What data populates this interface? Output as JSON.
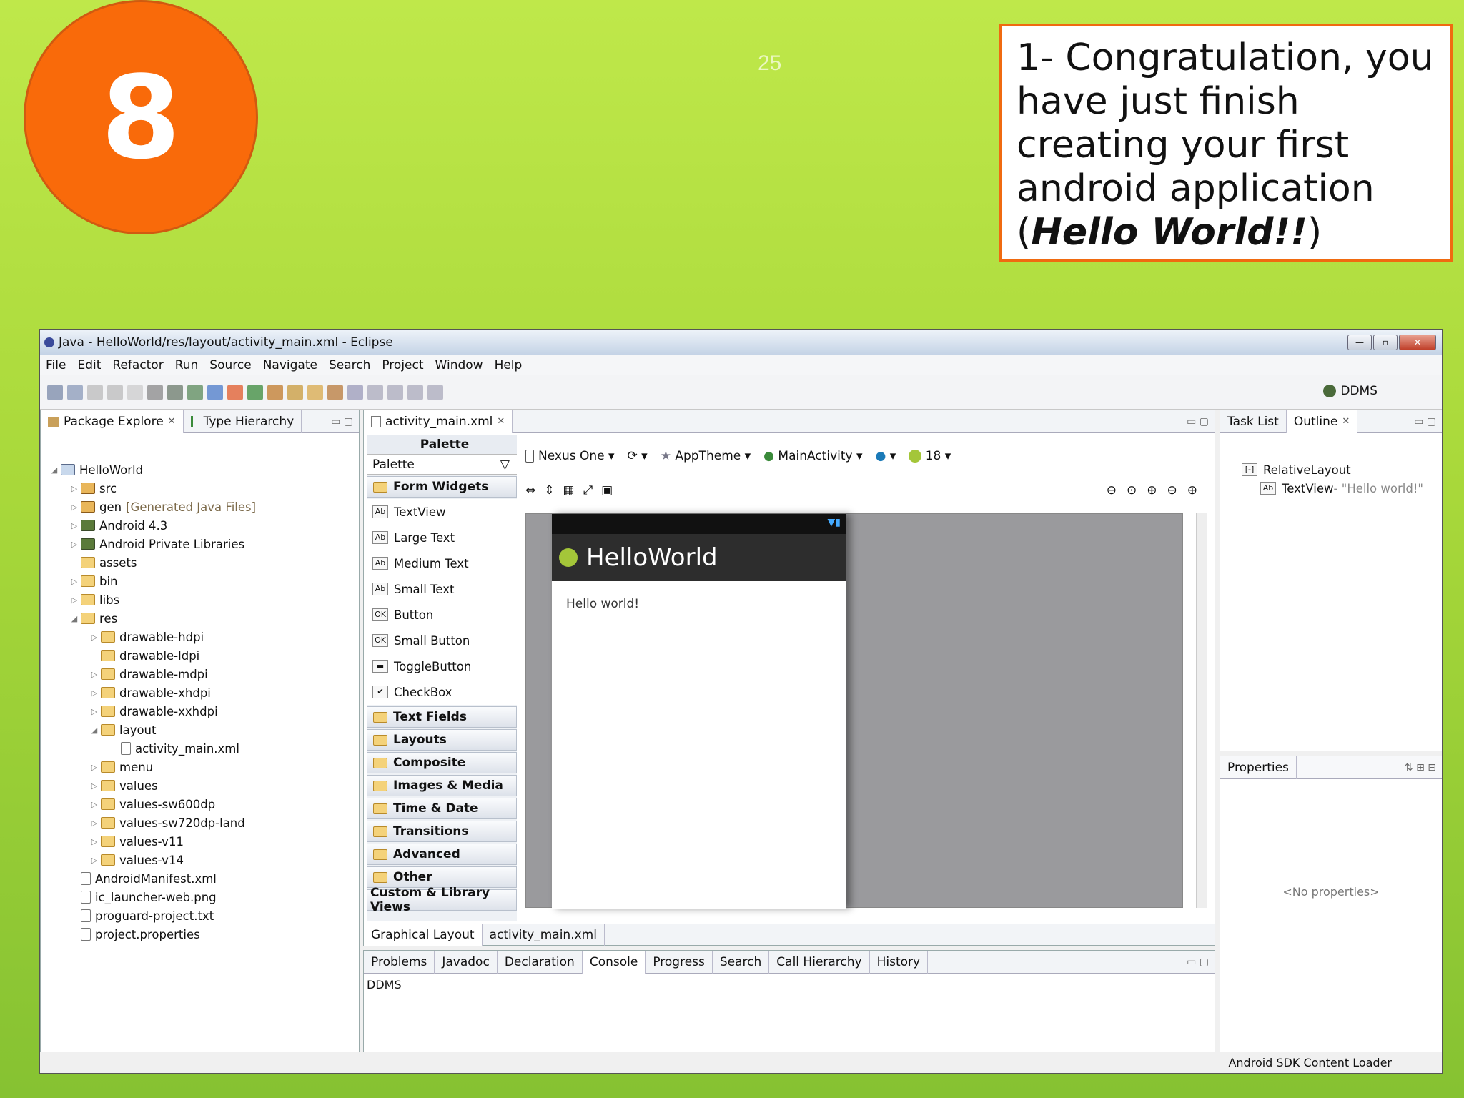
{
  "slide": {
    "step": "8",
    "page_number": "25",
    "callout_plain1": "1- Congratulation, you have just finish creating your first android application (",
    "callout_bold": "Hello World!!",
    "callout_plain2": ")"
  },
  "window": {
    "title": "Java - HelloWorld/res/layout/activity_main.xml - Eclipse"
  },
  "menu": [
    "File",
    "Edit",
    "Refactor",
    "Run",
    "Source",
    "Navigate",
    "Search",
    "Project",
    "Window",
    "Help"
  ],
  "toolbar": {
    "perspective": "DDMS"
  },
  "left_panel": {
    "tabs": [
      "Package Explore",
      "Type Hierarchy"
    ],
    "tree": [
      {
        "label": "HelloWorld",
        "level": 0,
        "tw": "◢",
        "type": "proj"
      },
      {
        "label": "src",
        "level": 1,
        "tw": "▷",
        "type": "pkg"
      },
      {
        "label": "gen",
        "note": "[Generated Java Files]",
        "level": 1,
        "tw": "▷",
        "type": "pkg"
      },
      {
        "label": "Android 4.3",
        "level": 1,
        "tw": "▷",
        "type": "lib"
      },
      {
        "label": "Android Private Libraries",
        "level": 1,
        "tw": "▷",
        "type": "lib"
      },
      {
        "label": "assets",
        "level": 1,
        "tw": "",
        "type": "folder"
      },
      {
        "label": "bin",
        "level": 1,
        "tw": "▷",
        "type": "folder"
      },
      {
        "label": "libs",
        "level": 1,
        "tw": "▷",
        "type": "folder"
      },
      {
        "label": "res",
        "level": 1,
        "tw": "◢",
        "type": "folder"
      },
      {
        "label": "drawable-hdpi",
        "level": 2,
        "tw": "▷",
        "type": "folder"
      },
      {
        "label": "drawable-ldpi",
        "level": 2,
        "tw": "",
        "type": "folder"
      },
      {
        "label": "drawable-mdpi",
        "level": 2,
        "tw": "▷",
        "type": "folder"
      },
      {
        "label": "drawable-xhdpi",
        "level": 2,
        "tw": "▷",
        "type": "folder"
      },
      {
        "label": "drawable-xxhdpi",
        "level": 2,
        "tw": "▷",
        "type": "folder"
      },
      {
        "label": "layout",
        "level": 2,
        "tw": "◢",
        "type": "folder"
      },
      {
        "label": "activity_main.xml",
        "level": 3,
        "tw": "",
        "type": "file"
      },
      {
        "label": "menu",
        "level": 2,
        "tw": "▷",
        "type": "folder"
      },
      {
        "label": "values",
        "level": 2,
        "tw": "▷",
        "type": "folder"
      },
      {
        "label": "values-sw600dp",
        "level": 2,
        "tw": "▷",
        "type": "folder"
      },
      {
        "label": "values-sw720dp-land",
        "level": 2,
        "tw": "▷",
        "type": "folder"
      },
      {
        "label": "values-v11",
        "level": 2,
        "tw": "▷",
        "type": "folder"
      },
      {
        "label": "values-v14",
        "level": 2,
        "tw": "▷",
        "type": "folder"
      },
      {
        "label": "AndroidManifest.xml",
        "level": 1,
        "tw": "",
        "type": "file"
      },
      {
        "label": "ic_launcher-web.png",
        "level": 1,
        "tw": "",
        "type": "file"
      },
      {
        "label": "proguard-project.txt",
        "level": 1,
        "tw": "",
        "type": "file"
      },
      {
        "label": "project.properties",
        "level": 1,
        "tw": "",
        "type": "file"
      }
    ]
  },
  "editor": {
    "tab": "activity_main.xml",
    "palette": {
      "title": "Palette",
      "dropdown": "Palette",
      "open_category": "Form Widgets",
      "widgets": [
        {
          "icon": "Ab",
          "label": "TextView"
        },
        {
          "icon": "Ab",
          "label": "Large Text"
        },
        {
          "icon": "Ab",
          "label": "Medium Text"
        },
        {
          "icon": "Ab",
          "label": "Small Text"
        },
        {
          "icon": "OK",
          "label": "Button"
        },
        {
          "icon": "OK",
          "label": "Small Button"
        },
        {
          "icon": "▬",
          "label": "ToggleButton"
        },
        {
          "icon": "✔",
          "label": "CheckBox"
        }
      ],
      "categories": [
        "Text Fields",
        "Layouts",
        "Composite",
        "Images & Media",
        "Time & Date",
        "Transitions",
        "Advanced",
        "Other"
      ],
      "custom": "Custom & Library Views"
    },
    "config": {
      "device": "Nexus One",
      "theme": "AppTheme",
      "activity": "MainActivity",
      "api": "18"
    },
    "phone": {
      "app_title": "HelloWorld",
      "text": "Hello world!"
    },
    "bottom_tabs": [
      "Graphical Layout",
      "activity_main.xml"
    ]
  },
  "right_panel": {
    "tabs": [
      "Task List",
      "Outline"
    ],
    "outline": [
      {
        "label": "RelativeLayout",
        "icon": "[-]"
      },
      {
        "label": "TextView",
        "icon": "Ab",
        "value": " - \"Hello world!\""
      }
    ],
    "properties_title": "Properties",
    "no_properties": "<No properties>"
  },
  "console": {
    "tabs": [
      "Problems",
      "Javadoc",
      "Declaration",
      "Console",
      "Progress",
      "Search",
      "Call Hierarchy",
      "History"
    ],
    "active": "Console",
    "label": "DDMS"
  },
  "status": {
    "text": "Android SDK Content Loader"
  }
}
